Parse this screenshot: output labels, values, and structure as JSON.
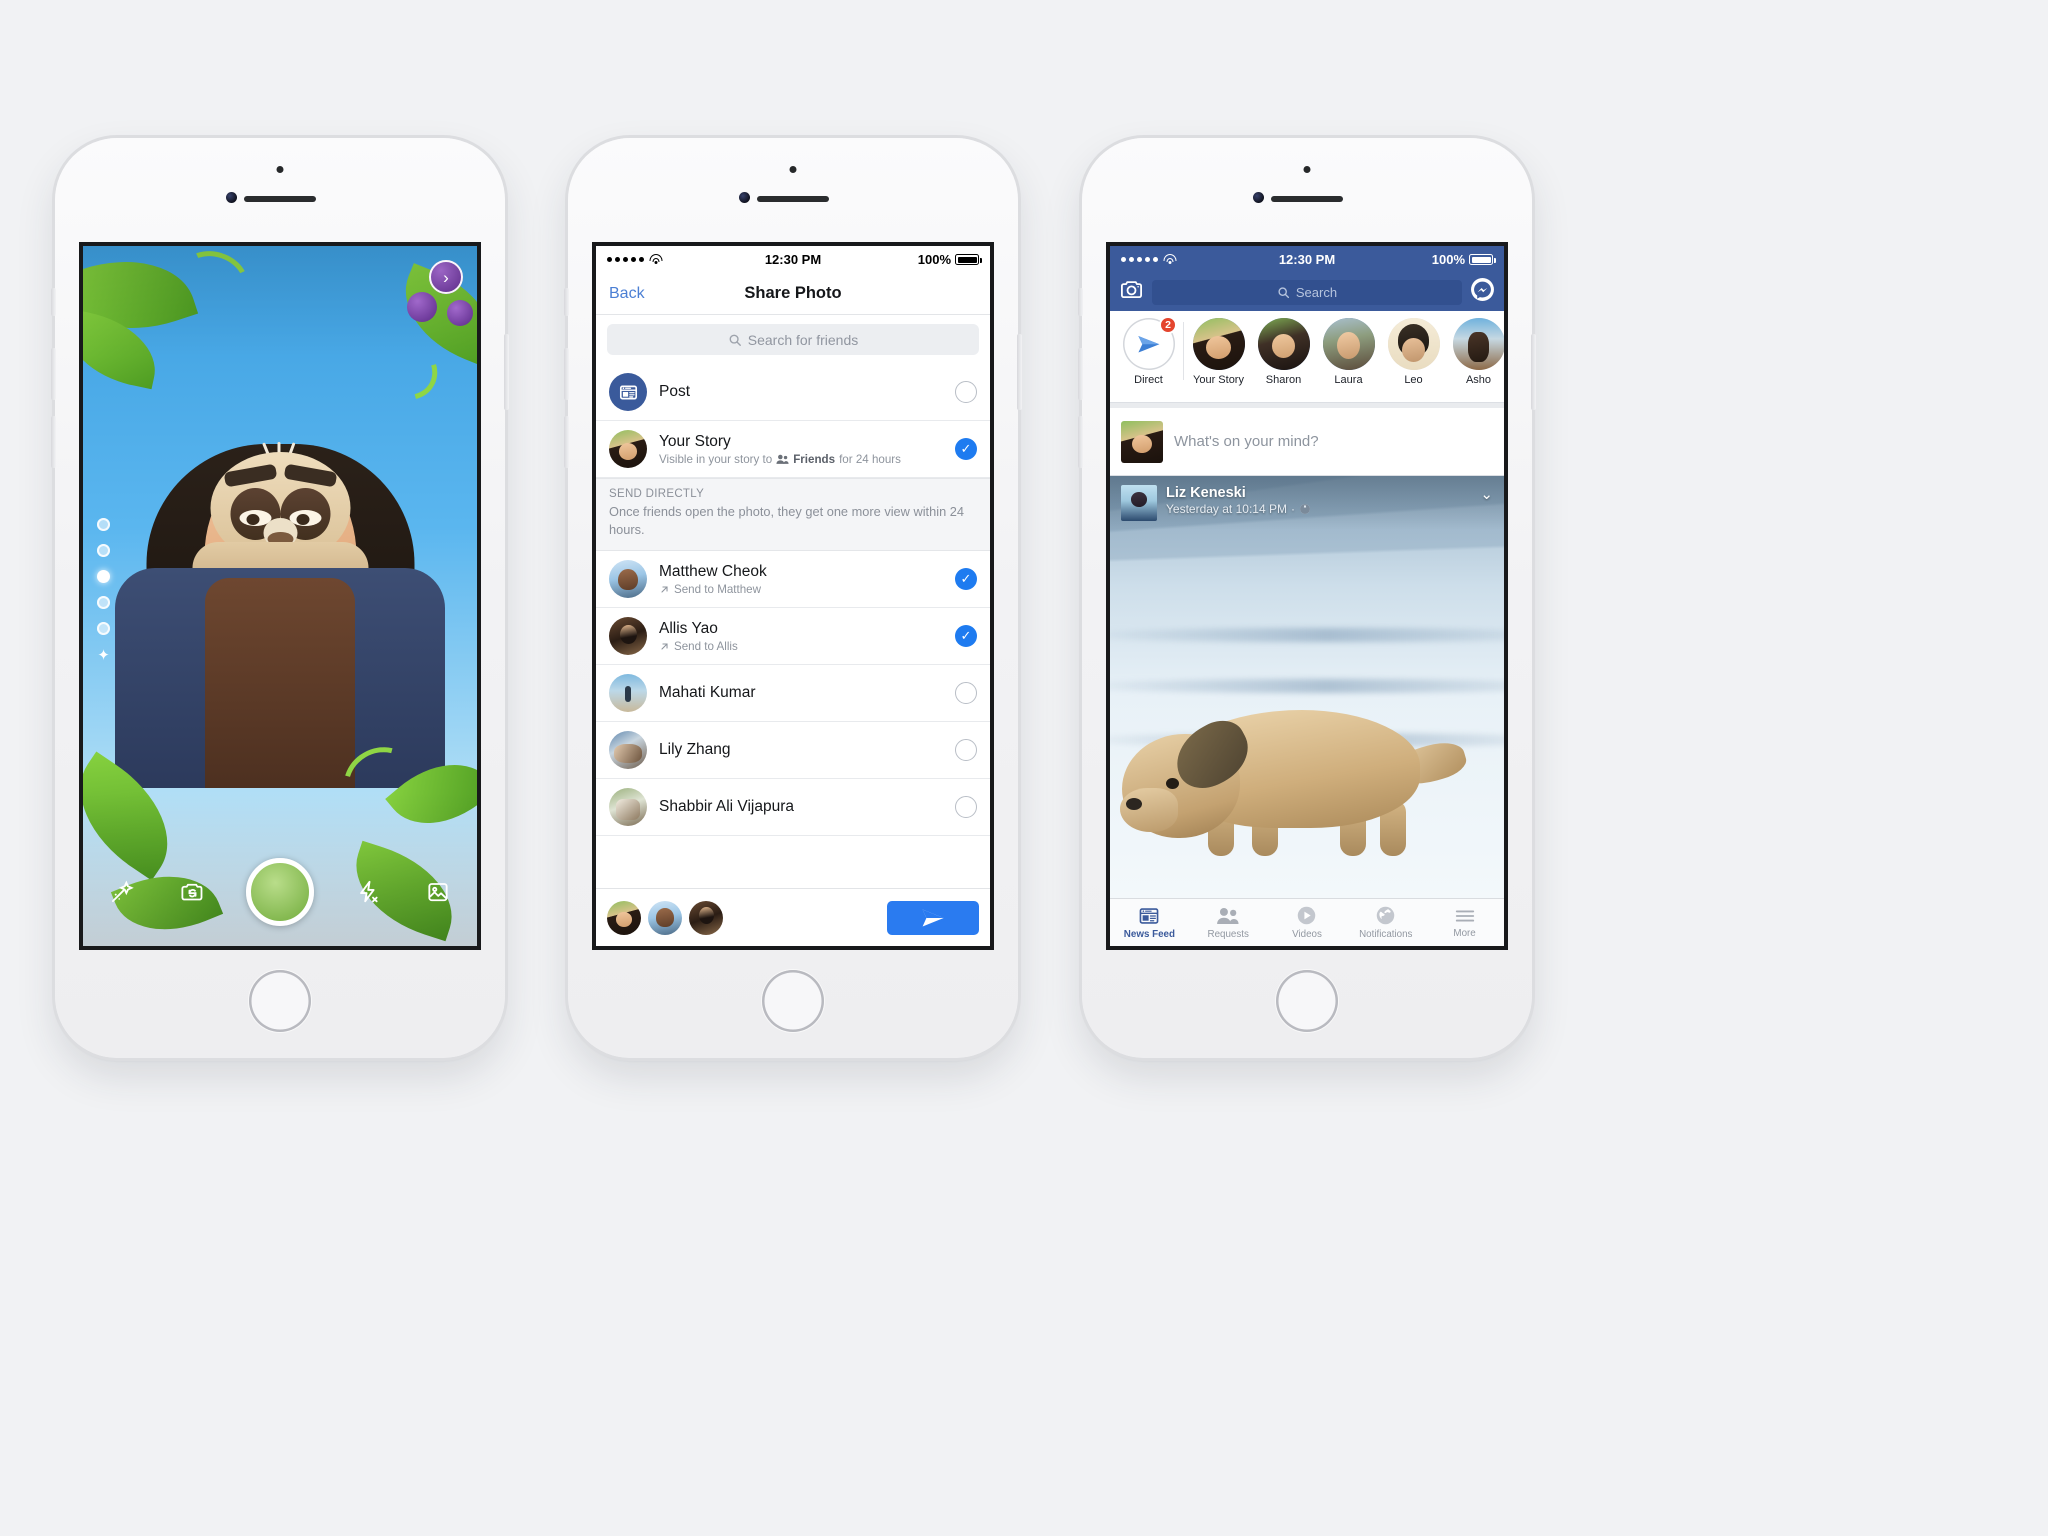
{
  "background_color": "#f1f2f4",
  "status_bar": {
    "time": "12:30 PM",
    "battery": "100%",
    "signal_dots": 5
  },
  "phone1_camera": {
    "name": "Facebook Camera",
    "next_button": "›",
    "effect_dots": 5,
    "active_dot_index": 2,
    "sparkle_icon": "✦",
    "controls": {
      "effects_label": "magic-wand-icon",
      "flip_label": "flip-camera-icon",
      "shutter_label": "shutter-button",
      "flash_label": "flash-off-icon",
      "gallery_label": "gallery-icon"
    }
  },
  "phone2_share": {
    "nav": {
      "back": "Back",
      "title": "Share Photo"
    },
    "search": {
      "placeholder": "Search for friends"
    },
    "rows": [
      {
        "name": "Post",
        "sub": "",
        "type": "post",
        "selected": false,
        "avatar": "post-icon"
      },
      {
        "name": "Your Story",
        "sub_pre": "Visible in your story to",
        "sub_bold": "Friends",
        "sub_post": "for 24 hours",
        "type": "story",
        "selected": true,
        "avatar": "p-girl"
      }
    ],
    "section": {
      "title": "SEND DIRECTLY",
      "description": "Once friends open the photo, they get one more view within 24 hours."
    },
    "friends": [
      {
        "name": "Matthew Cheok",
        "sub": "Send to Matthew",
        "selected": true,
        "avatar": "p-guy"
      },
      {
        "name": "Allis Yao",
        "sub": "Send to Allis",
        "selected": true,
        "avatar": "p-allis"
      },
      {
        "name": "Mahati Kumar",
        "sub": "",
        "selected": false,
        "avatar": "p-beach"
      },
      {
        "name": "Lily Zhang",
        "sub": "",
        "selected": false,
        "avatar": "p-group"
      },
      {
        "name": "Shabbir Ali Vijapura",
        "sub": "",
        "selected": false,
        "avatar": "p-couple"
      }
    ],
    "send_bar": {
      "recipients": [
        "p-girl",
        "p-guy",
        "p-allis"
      ],
      "send_button": "send-icon"
    },
    "accent_color": "#1e7bf0"
  },
  "phone3_feed": {
    "header": {
      "camera_icon": "camera-icon",
      "search_placeholder": "Search",
      "messenger_icon": "messenger-icon",
      "brand_color": "#3b5a9b"
    },
    "stories": [
      {
        "label": "Direct",
        "type": "direct",
        "badge": "2",
        "avatar": ""
      },
      {
        "label": "Your Story",
        "type": "ring",
        "badge": "",
        "avatar": "p-girl"
      },
      {
        "label": "Sharon",
        "type": "ring",
        "badge": "",
        "avatar": "p-sharon"
      },
      {
        "label": "Laura",
        "type": "ring",
        "badge": "",
        "avatar": "p-laura"
      },
      {
        "label": "Leo",
        "type": "seen",
        "badge": "",
        "avatar": "p-leo"
      },
      {
        "label": "Asho",
        "type": "seen",
        "badge": "",
        "avatar": "p-ashok"
      }
    ],
    "composer": {
      "placeholder": "What's on your mind?",
      "avatar": "p-girl"
    },
    "post": {
      "author": "Liz Keneski",
      "timestamp": "Yesterday at 10:14 PM",
      "privacy_icon": "globe-icon",
      "chevron": "chevron-down-icon",
      "avatar": "p-liz"
    },
    "tabs": [
      {
        "label": "News Feed",
        "icon": "news-feed-icon",
        "active": true
      },
      {
        "label": "Requests",
        "icon": "friends-icon",
        "active": false
      },
      {
        "label": "Videos",
        "icon": "play-icon",
        "active": false
      },
      {
        "label": "Notifications",
        "icon": "globe-icon",
        "active": false
      },
      {
        "label": "More",
        "icon": "hamburger-icon",
        "active": false
      }
    ]
  }
}
